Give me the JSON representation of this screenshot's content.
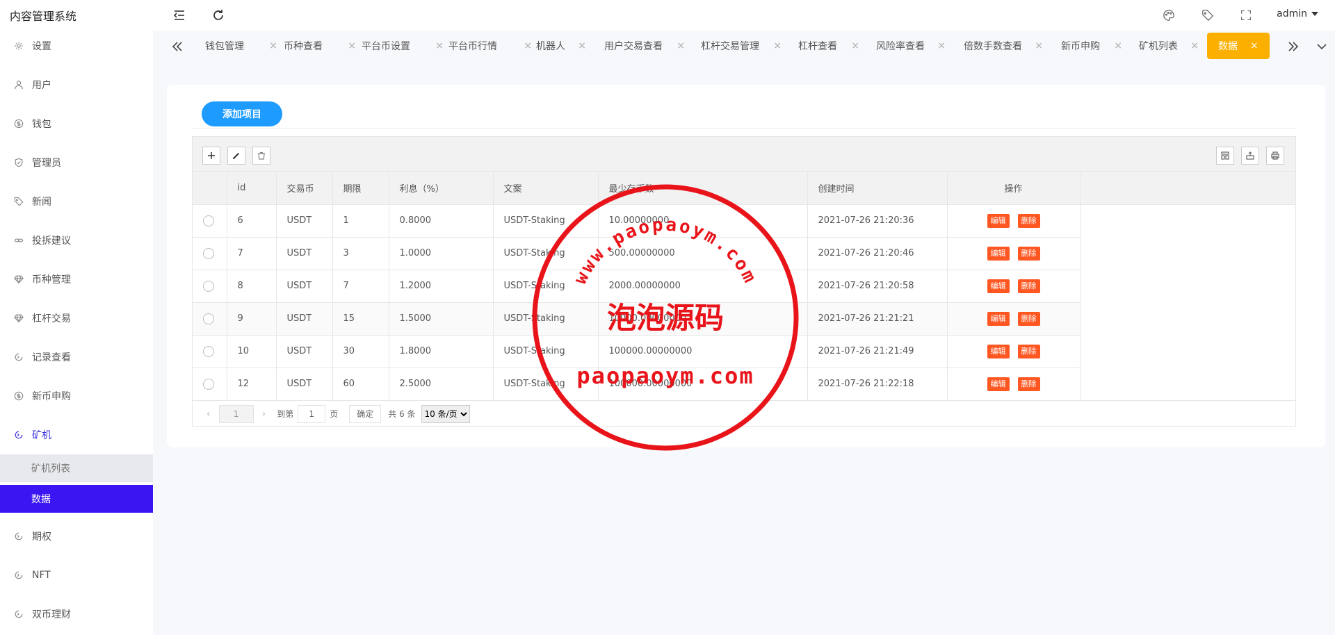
{
  "header": {
    "brand": "内容管理系统",
    "user": "admin"
  },
  "sidebar": {
    "items": [
      {
        "label": "设置",
        "icon": "gear-icon"
      },
      {
        "label": "用户",
        "icon": "user-icon"
      },
      {
        "label": "钱包",
        "icon": "dollar-icon"
      },
      {
        "label": "管理员",
        "icon": "shield-icon"
      },
      {
        "label": "新闻",
        "icon": "tag-icon"
      },
      {
        "label": "投拆建议",
        "icon": "link-icon"
      },
      {
        "label": "币种管理",
        "icon": "diamond-icon"
      },
      {
        "label": "杠杆交易",
        "icon": "diamond-icon"
      },
      {
        "label": "记录查看",
        "icon": "circle-arrow-icon"
      },
      {
        "label": "新币申购",
        "icon": "dollar-icon"
      },
      {
        "label": "矿机",
        "icon": "circle-arrow-icon"
      },
      {
        "label": "期权",
        "icon": "circle-arrow-icon"
      },
      {
        "label": "NFT",
        "icon": "circle-arrow-icon"
      },
      {
        "label": "双币理财",
        "icon": "circle-arrow-icon"
      }
    ],
    "sub_items": [
      {
        "label": "矿机列表"
      },
      {
        "label": "数据"
      }
    ]
  },
  "tabs": [
    {
      "label": "钱包管理"
    },
    {
      "label": "币种查看"
    },
    {
      "label": "平台币设置"
    },
    {
      "label": "平台币行情"
    },
    {
      "label": "机器人"
    },
    {
      "label": "用户交易查看"
    },
    {
      "label": "杠杆交易管理"
    },
    {
      "label": "杠杆查看"
    },
    {
      "label": "风险率查看"
    },
    {
      "label": "倍数手数查看"
    },
    {
      "label": "新币申购"
    },
    {
      "label": "矿机列表"
    },
    {
      "label": "数据"
    }
  ],
  "tab_close_glyph": "×",
  "content": {
    "add_button": "添加项目",
    "columns": [
      "id",
      "交易币",
      "期限",
      "利息（%）",
      "文案",
      "最少存币数",
      "创建时间",
      "操作"
    ],
    "rows": [
      {
        "id": "6",
        "coin": "USDT",
        "term": "1",
        "interest": "0.8000",
        "text": "USDT-Staking",
        "min": "10.00000000",
        "created": "2021-07-26 21:20:36"
      },
      {
        "id": "7",
        "coin": "USDT",
        "term": "3",
        "interest": "1.0000",
        "text": "USDT-Staking",
        "min": "500.00000000",
        "created": "2021-07-26 21:20:46"
      },
      {
        "id": "8",
        "coin": "USDT",
        "term": "7",
        "interest": "1.2000",
        "text": "USDT-Staking",
        "min": "2000.00000000",
        "created": "2021-07-26 21:20:58"
      },
      {
        "id": "9",
        "coin": "USDT",
        "term": "15",
        "interest": "1.5000",
        "text": "USDT-Staking",
        "min": "10000.00000000",
        "created": "2021-07-26 21:21:21"
      },
      {
        "id": "10",
        "coin": "USDT",
        "term": "30",
        "interest": "1.8000",
        "text": "USDT-Staking",
        "min": "100000.00000000",
        "created": "2021-07-26 21:21:49"
      },
      {
        "id": "12",
        "coin": "USDT",
        "term": "60",
        "interest": "2.5000",
        "text": "USDT-Staking",
        "min": "100000.00000000",
        "created": "2021-07-26 21:22:18"
      }
    ],
    "edit_label": "编辑",
    "delete_label": "删除"
  },
  "pager": {
    "prev": "‹",
    "next": "›",
    "current": "1",
    "goto_label": "到第",
    "goto_value": "1",
    "page_unit": "页",
    "confirm": "确定",
    "total": "共 6 条",
    "page_size": "10 条/页"
  },
  "watermark": {
    "arc_text": "www.paopaoym.com",
    "title": "泡泡源码",
    "bottom": "paopaoym.com",
    "color": "#e8141a"
  },
  "colors": {
    "accent": "#3b16f2",
    "tab_active": "#fbb000",
    "add_button": "#1e9bff",
    "danger": "#ff5722"
  }
}
